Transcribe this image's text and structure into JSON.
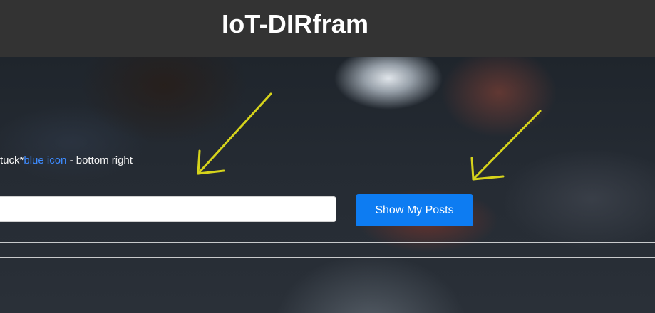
{
  "header": {
    "title": "IoT-DIRfram"
  },
  "hint": {
    "prefix": "tuck*",
    "link_text": "blue icon",
    "suffix": " - bottom right"
  },
  "input": {
    "value": "",
    "placeholder": ""
  },
  "button": {
    "label": "Show My Posts"
  },
  "colors": {
    "header_bg": "#333333",
    "button_bg": "#0d7cf2",
    "hint_link": "#3d8bff",
    "arrow": "#e6e21a"
  },
  "icons": {
    "arrow_left": "arrow-down-left-icon",
    "arrow_right": "arrow-down-left-icon"
  }
}
